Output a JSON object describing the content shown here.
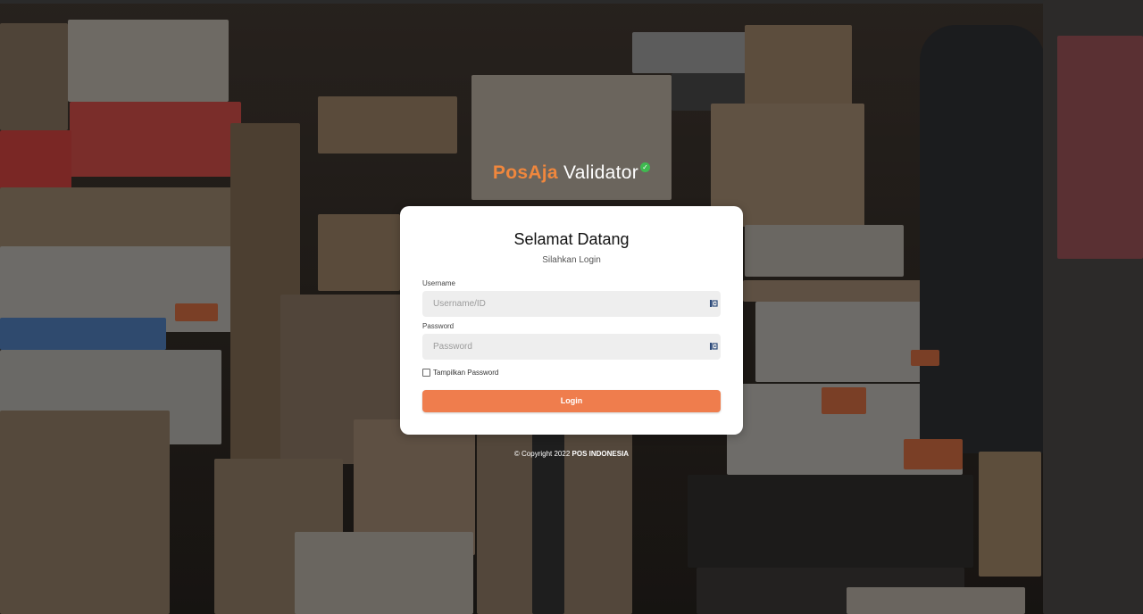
{
  "brand": {
    "part1": "PosAja",
    "part2": "Validator",
    "colors": {
      "accent": "#f0873d",
      "check": "#3fb950"
    }
  },
  "login": {
    "title": "Selamat Datang",
    "subtitle": "Silahkan Login",
    "username_label": "Username",
    "username_value": "",
    "username_placeholder": "Username/ID",
    "password_label": "Password",
    "password_value": "",
    "password_placeholder": "Password",
    "show_password_label": "Tampilkan Password",
    "show_password_checked": false,
    "login_button_label": "Login",
    "button_color": "#ef7d4d"
  },
  "footer": {
    "copyright_prefix": "© Copyright 2022",
    "copyright_org": "POS INDONESIA"
  },
  "background": {
    "description_icons": "blurred-warehouse-boxes"
  }
}
